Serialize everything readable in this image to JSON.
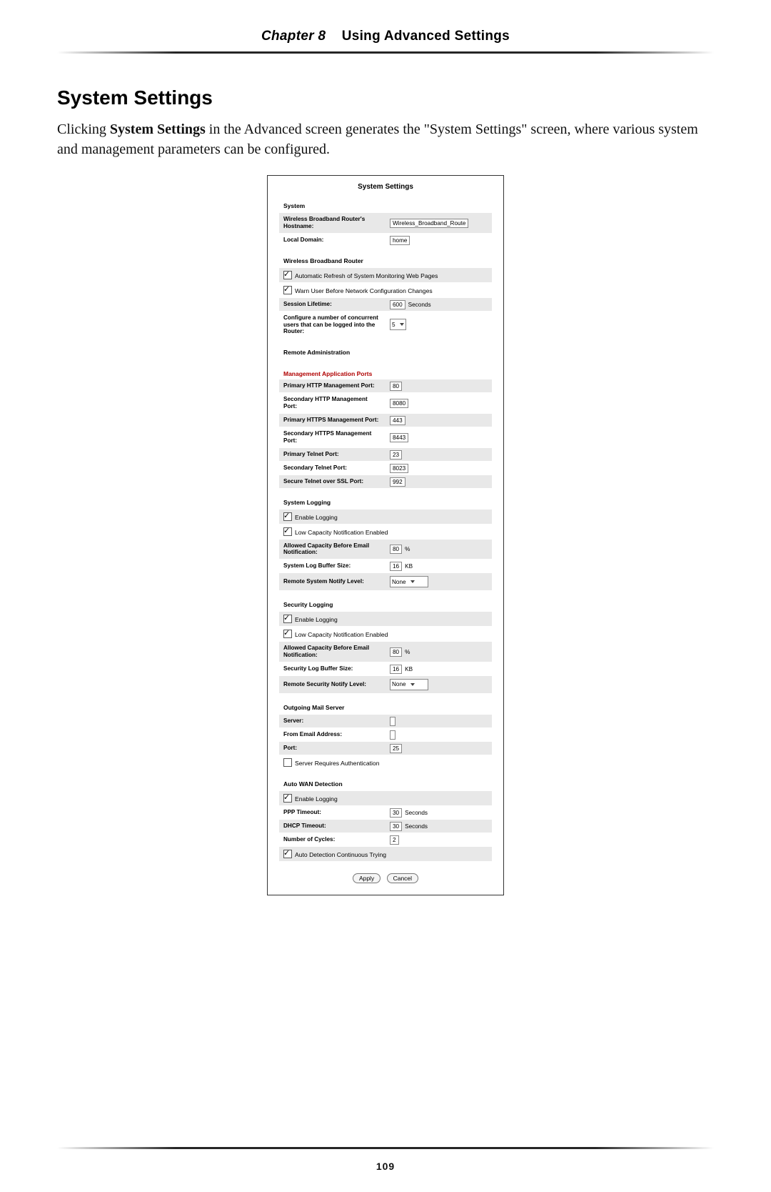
{
  "chapter": {
    "prefix": "Chapter 8",
    "title": "Using Advanced Settings"
  },
  "section_title": "System Settings",
  "intro_before": "Clicking ",
  "intro_bold": "System Settings",
  "intro_after": " in the Advanced screen generates the \"System Settings\" screen, where various system and management parameters can be configured.",
  "page_number": "109",
  "panel": {
    "title": "System Settings",
    "groups": {
      "system": {
        "heading": "System",
        "hostname_label": "Wireless Broadband Router's Hostname:",
        "hostname_value": "Wireless_Broadband_Route",
        "localdomain_label": "Local Domain:",
        "localdomain_value": "home"
      },
      "wbr": {
        "heading": "Wireless Broadband Router",
        "auto_refresh": "Automatic Refresh of System Monitoring Web Pages",
        "auto_refresh_checked": true,
        "warn_user": "Warn User Before Network Configuration Changes",
        "warn_user_checked": true,
        "session_label": "Session Lifetime:",
        "session_value": "600",
        "session_unit": "Seconds",
        "concurrent_label": "Configure a number of concurrent users that can be logged into the Router:",
        "concurrent_value": "5"
      },
      "remote_admin": {
        "heading": "Remote Administration"
      },
      "mgmt_ports": {
        "heading": "Management Application Ports",
        "p_http_label": "Primary HTTP Management Port:",
        "p_http_value": "80",
        "s_http_label": "Secondary HTTP Management Port:",
        "s_http_value": "8080",
        "p_https_label": "Primary HTTPS Management Port:",
        "p_https_value": "443",
        "s_https_label": "Secondary HTTPS Management Port:",
        "s_https_value": "8443",
        "p_telnet_label": "Primary Telnet Port:",
        "p_telnet_value": "23",
        "s_telnet_label": "Secondary Telnet Port:",
        "s_telnet_value": "8023",
        "ssl_telnet_label": "Secure Telnet over SSL Port:",
        "ssl_telnet_value": "992"
      },
      "sys_log": {
        "heading": "System Logging",
        "enable": "Enable Logging",
        "enable_checked": true,
        "lowcap": "Low Capacity Notification Enabled",
        "lowcap_checked": true,
        "allowed_label": "Allowed Capacity Before Email Notification:",
        "allowed_value": "80",
        "allowed_unit": "%",
        "buf_label": "System Log Buffer Size:",
        "buf_value": "16",
        "buf_unit": "KB",
        "notify_label": "Remote System Notify Level:",
        "notify_value": "None"
      },
      "sec_log": {
        "heading": "Security Logging",
        "enable": "Enable Logging",
        "enable_checked": true,
        "lowcap": "Low Capacity Notification Enabled",
        "lowcap_checked": true,
        "allowed_label": "Allowed Capacity Before Email Notification:",
        "allowed_value": "80",
        "allowed_unit": "%",
        "buf_label": "Security Log Buffer Size:",
        "buf_value": "16",
        "buf_unit": "KB",
        "notify_label": "Remote Security Notify Level:",
        "notify_value": "None"
      },
      "mail": {
        "heading": "Outgoing Mail Server",
        "server_label": "Server:",
        "server_value": "",
        "from_label": "From Email Address:",
        "from_value": "",
        "port_label": "Port:",
        "port_value": "25",
        "auth": "Server Requires Authentication",
        "auth_checked": false
      },
      "wan": {
        "heading": "Auto WAN Detection",
        "enable": "Enable Logging",
        "enable_checked": true,
        "ppp_label": "PPP Timeout:",
        "ppp_value": "30",
        "ppp_unit": "Seconds",
        "dhcp_label": "DHCP Timeout:",
        "dhcp_value": "30",
        "dhcp_unit": "Seconds",
        "cycles_label": "Number of Cycles:",
        "cycles_value": "2",
        "cont": "Auto Detection Continuous Trying",
        "cont_checked": true
      }
    },
    "buttons": {
      "apply": "Apply",
      "cancel": "Cancel"
    }
  }
}
